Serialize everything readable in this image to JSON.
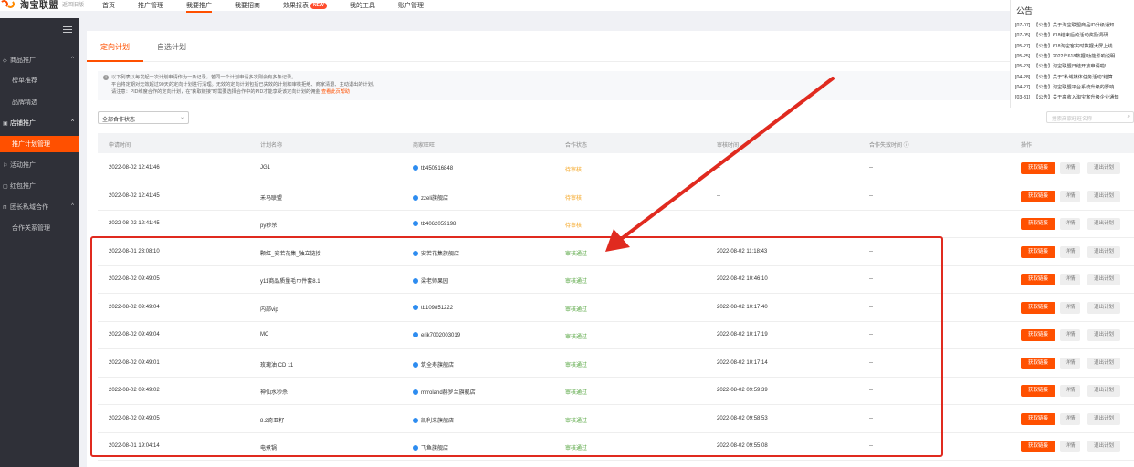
{
  "brand": {
    "name": "淘宝联盟",
    "back_label": "返回旧版"
  },
  "nav": [
    "首页",
    "推广管理",
    "我要推广",
    "我要招商",
    "效果报表",
    "我的工具",
    "账户管理"
  ],
  "nav_badge": "NEW",
  "sidebar": {
    "groups": [
      {
        "label": "商品推广",
        "caret": "^"
      },
      {
        "label": "店铺推广",
        "caret": "^"
      },
      {
        "label": "活动推广"
      },
      {
        "label": "红包推广"
      },
      {
        "label": "团长私域合作",
        "caret": "^"
      }
    ],
    "items": [
      "榜单推荐",
      "品牌精选",
      "推广计划管理",
      "合作关系管理"
    ]
  },
  "tabs": [
    "定向计划",
    "自选计划"
  ],
  "notice": {
    "line1": "以下列表以每发起一次计划申请作为一条记录，若同一个计划申请多次则会有多条记录。",
    "line2": "平台将定期对无效超过90天的定向计划进行清理。无效的定向计划包括已失效的计划和审核拒绝、商家清退、主动退出的计划。",
    "line3": "请注意：PID维度合作的定向计划，在\"获取链接\"时需要选择合作中的PID才能享受该定向计划的佣金",
    "link": "查看此页帮助"
  },
  "filter": {
    "value": "全部合作状态"
  },
  "search": {
    "placeholder": "搜索商家旺旺名称"
  },
  "table": {
    "headers": [
      "申请时间",
      "计划名称",
      "商家旺旺",
      "合作状态",
      "审核时间",
      "合作失效时间 ⓘ",
      "操作"
    ],
    "actions": [
      "获取链接",
      "详情",
      "退出计划"
    ],
    "rows": [
      {
        "apply_time": "2022-08-02 12:41:46",
        "plan": "JG1",
        "shop": "tb450516848",
        "status": "待审核",
        "status_type": "pending",
        "review_time": "--",
        "expire": "--"
      },
      {
        "apply_time": "2022-08-02 12:41:45",
        "plan": "禾马联盟",
        "shop": "zzeli旗舰店",
        "status": "待审核",
        "status_type": "pending",
        "review_time": "--",
        "expire": "--"
      },
      {
        "apply_time": "2022-08-02 12:41:45",
        "plan": "py秒杀",
        "shop": "tb4062059198",
        "status": "待审核",
        "status_type": "pending",
        "review_time": "--",
        "expire": "--"
      },
      {
        "apply_time": "2022-08-01 23:08:10",
        "plan": "颗红_安若花集_独立链接",
        "shop": "安若花集旗舰店",
        "status": "审核通过",
        "status_type": "pass",
        "review_time": "2022-08-02 11:18:43",
        "expire": "--"
      },
      {
        "apply_time": "2022-08-02 09:49:05",
        "plan": "y11商品质量毛巾件套8.1",
        "shop": "梁老师果园",
        "status": "审核通过",
        "status_type": "pass",
        "review_time": "2022-08-02 10:46:10",
        "expire": "--"
      },
      {
        "apply_time": "2022-08-02 09:49:04",
        "plan": "内部vip",
        "shop": "tb109851222",
        "status": "审核通过",
        "status_type": "pass",
        "review_time": "2022-08-02 10:17:40",
        "expire": "--"
      },
      {
        "apply_time": "2022-08-02 09:49:04",
        "plan": "MC",
        "shop": "erik7002003019",
        "status": "审核通过",
        "status_type": "pass",
        "review_time": "2022-08-02 10:17:19",
        "expire": "--"
      },
      {
        "apply_time": "2022-08-02 09:49:01",
        "plan": "玫瑰油 CD 11",
        "shop": "筑全寿旗舰店",
        "status": "审核通过",
        "status_type": "pass",
        "review_time": "2022-08-02 10:17:14",
        "expire": "--"
      },
      {
        "apply_time": "2022-08-02 09:49:02",
        "plan": "神仙水秒杀",
        "shop": "mrroland赫罗兰旗舰店",
        "status": "审核通过",
        "status_type": "pass",
        "review_time": "2022-08-02 09:59:39",
        "expire": "--"
      },
      {
        "apply_time": "2022-08-02 09:49:05",
        "plan": "8.2奇亚籽",
        "shop": "凯利来旗舰店",
        "status": "审核通过",
        "status_type": "pass",
        "review_time": "2022-08-02 09:58:53",
        "expire": "--"
      },
      {
        "apply_time": "2022-08-01 19:04:14",
        "plan": "电煮锅",
        "shop": "飞鱼旗舰店",
        "status": "审核通过",
        "status_type": "pass",
        "review_time": "2022-08-02 09:55:08",
        "expire": "--"
      }
    ]
  },
  "announcement": {
    "title": "公告",
    "items": [
      {
        "date": "[07-07]",
        "text": "【公告】关于淘宝联盟商品ID升级通知"
      },
      {
        "date": "[07-05]",
        "text": "【公告】618结束后的活动奖励调研"
      },
      {
        "date": "[05-27]",
        "text": "【公告】618淘宝客实时数据大屏上线"
      },
      {
        "date": "[05-25]",
        "text": "【公告】2022年618数据/功能影响说明"
      },
      {
        "date": "[05-23]",
        "text": "【公告】淘宝联盟日结开放申请啦!"
      },
      {
        "date": "[04-28]",
        "text": "【公告】关于\"私域媒体任务活动\"结算"
      },
      {
        "date": "[04-27]",
        "text": "【公告】淘宝联盟平台系统升级的影响"
      },
      {
        "date": "[03-31]",
        "text": "【公告】关于高收入淘宝客升级企业通知"
      }
    ]
  },
  "annotation_colors": {
    "highlight": "#e02a1f",
    "accent": "#ff5000"
  }
}
